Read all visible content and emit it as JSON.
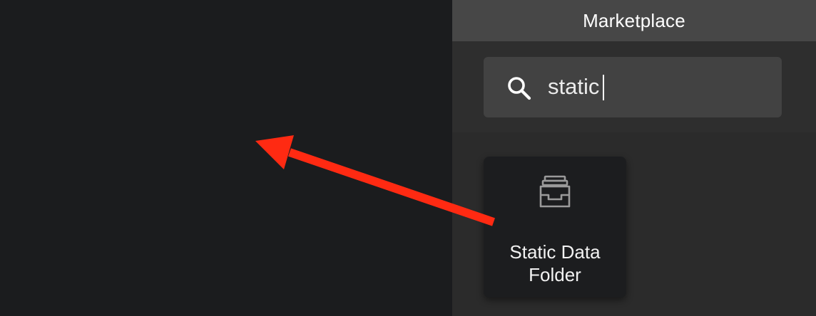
{
  "panel": {
    "title": "Marketplace"
  },
  "search": {
    "value": "static",
    "icon": "search-icon"
  },
  "results": [
    {
      "label_line1": "Static Data",
      "label_line2": "Folder",
      "icon": "folder-tray-icon"
    }
  ],
  "colors": {
    "canvas_bg": "#1b1c1e",
    "panel_bg": "#2b2b2b",
    "header_bg": "#474747",
    "search_box_bg": "#424242",
    "card_bg": "#1c1d1f",
    "annotation_arrow": "#ff2a12"
  }
}
